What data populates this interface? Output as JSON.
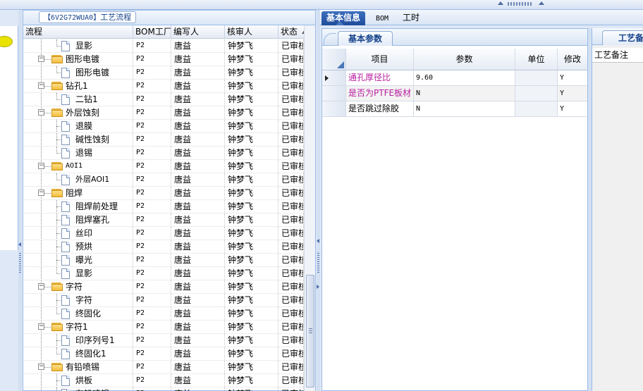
{
  "tree_panel": {
    "title_code": "【6V2G72WUA0】",
    "title_text": "工艺流程",
    "columns": [
      "流程",
      "BOM工厂",
      "编写人",
      "核审人",
      "状态"
    ],
    "rows": [
      {
        "name": "显影",
        "type": "doc",
        "bom": "P2",
        "writer": "唐益",
        "reviewer": "钟梦飞",
        "status": "已审核"
      },
      {
        "name": "图形电镀",
        "type": "folder",
        "bom": "P2",
        "writer": "唐益",
        "reviewer": "钟梦飞",
        "status": "已审核"
      },
      {
        "name": "图形电镀",
        "type": "doc",
        "bom": "P2",
        "writer": "唐益",
        "reviewer": "钟梦飞",
        "status": "已审核"
      },
      {
        "name": "钻孔1",
        "type": "folder",
        "bom": "P2",
        "writer": "唐益",
        "reviewer": "钟梦飞",
        "status": "已审核"
      },
      {
        "name": "二钻1",
        "type": "doc",
        "bom": "P2",
        "writer": "唐益",
        "reviewer": "钟梦飞",
        "status": "已审核"
      },
      {
        "name": "外层蚀刻",
        "type": "folder",
        "bom": "P2",
        "writer": "唐益",
        "reviewer": "钟梦飞",
        "status": "已审核"
      },
      {
        "name": "退膜",
        "type": "doc",
        "bom": "P2",
        "writer": "唐益",
        "reviewer": "钟梦飞",
        "status": "已审核"
      },
      {
        "name": "碱性蚀刻",
        "type": "doc",
        "bom": "P2",
        "writer": "唐益",
        "reviewer": "钟梦飞",
        "status": "已审核"
      },
      {
        "name": "退锡",
        "type": "doc",
        "bom": "P2",
        "writer": "唐益",
        "reviewer": "钟梦飞",
        "status": "已审核"
      },
      {
        "name": "AOI1",
        "type": "folder",
        "bom": "P2",
        "writer": "唐益",
        "reviewer": "钟梦飞",
        "status": "已审核"
      },
      {
        "name": "外层AOI1",
        "type": "doc",
        "bom": "P2",
        "writer": "唐益",
        "reviewer": "钟梦飞",
        "status": "已审核"
      },
      {
        "name": "阻焊",
        "type": "folder",
        "bom": "P2",
        "writer": "唐益",
        "reviewer": "钟梦飞",
        "status": "已审核"
      },
      {
        "name": "阻焊前处理",
        "type": "doc",
        "bom": "P2",
        "writer": "唐益",
        "reviewer": "钟梦飞",
        "status": "已审核"
      },
      {
        "name": "阻焊塞孔",
        "type": "doc",
        "bom": "P2",
        "writer": "唐益",
        "reviewer": "钟梦飞",
        "status": "已审核"
      },
      {
        "name": "丝印",
        "type": "doc",
        "bom": "P2",
        "writer": "唐益",
        "reviewer": "钟梦飞",
        "status": "已审核"
      },
      {
        "name": "预烘",
        "type": "doc",
        "bom": "P2",
        "writer": "唐益",
        "reviewer": "钟梦飞",
        "status": "已审核"
      },
      {
        "name": "曝光",
        "type": "doc",
        "bom": "P2",
        "writer": "唐益",
        "reviewer": "钟梦飞",
        "status": "已审核"
      },
      {
        "name": "显影",
        "type": "doc",
        "bom": "P2",
        "writer": "唐益",
        "reviewer": "钟梦飞",
        "status": "已审核"
      },
      {
        "name": "字符",
        "type": "folder",
        "bom": "P2",
        "writer": "唐益",
        "reviewer": "钟梦飞",
        "status": "已审核"
      },
      {
        "name": "字符",
        "type": "doc",
        "bom": "P2",
        "writer": "唐益",
        "reviewer": "钟梦飞",
        "status": "已审核"
      },
      {
        "name": "终固化",
        "type": "doc",
        "bom": "P2",
        "writer": "唐益",
        "reviewer": "钟梦飞",
        "status": "已审核"
      },
      {
        "name": "字符1",
        "type": "folder",
        "bom": "P2",
        "writer": "唐益",
        "reviewer": "钟梦飞",
        "status": "已审核"
      },
      {
        "name": "印序列号1",
        "type": "doc",
        "bom": "P2",
        "writer": "唐益",
        "reviewer": "钟梦飞",
        "status": "已审核"
      },
      {
        "name": "终固化1",
        "type": "doc",
        "bom": "P2",
        "writer": "唐益",
        "reviewer": "钟梦飞",
        "status": "已审核"
      },
      {
        "name": "有铅喷锡",
        "type": "folder",
        "bom": "P2",
        "writer": "唐益",
        "reviewer": "钟梦飞",
        "status": "已审核"
      },
      {
        "name": "烘板",
        "type": "doc",
        "bom": "P2",
        "writer": "唐益",
        "reviewer": "钟梦飞",
        "status": "已审核"
      },
      {
        "name": "有铅喷锡",
        "type": "doc",
        "bom": "P2",
        "writer": "唐益",
        "reviewer": "钟梦飞",
        "status": "已审核"
      }
    ]
  },
  "tabs": [
    {
      "label": "基本信息",
      "active": true
    },
    {
      "label": "BOM",
      "active": false
    },
    {
      "label": "工时",
      "active": false
    }
  ],
  "params_panel": {
    "title": "基本参数",
    "columns": [
      "项目",
      "参数",
      "单位",
      "修改"
    ],
    "rows": [
      {
        "item": "通孔厚径比",
        "value": "9.60",
        "unit": "",
        "modified": "Y",
        "pink": true,
        "selected": true
      },
      {
        "item": "是否为PTFE板材",
        "value": "N",
        "unit": "",
        "modified": "Y",
        "pink": true,
        "selected": false
      },
      {
        "item": "是否跳过除胶",
        "value": "N",
        "unit": "",
        "modified": "Y",
        "pink": false,
        "selected": false
      }
    ]
  },
  "notes_panel": {
    "title": "工艺备注",
    "field_label": "工艺备注"
  },
  "colors": {
    "accent": "#1f4d9b",
    "border": "#99bbe8",
    "panel_bg": "#dfe8f6",
    "highlight_text": "#b81c9f",
    "folder": "#f2bd3c"
  },
  "icons": [
    "folder-icon",
    "document-icon",
    "expand-minus-icon",
    "sort-ascending-icon",
    "row-pointer-icon"
  ]
}
